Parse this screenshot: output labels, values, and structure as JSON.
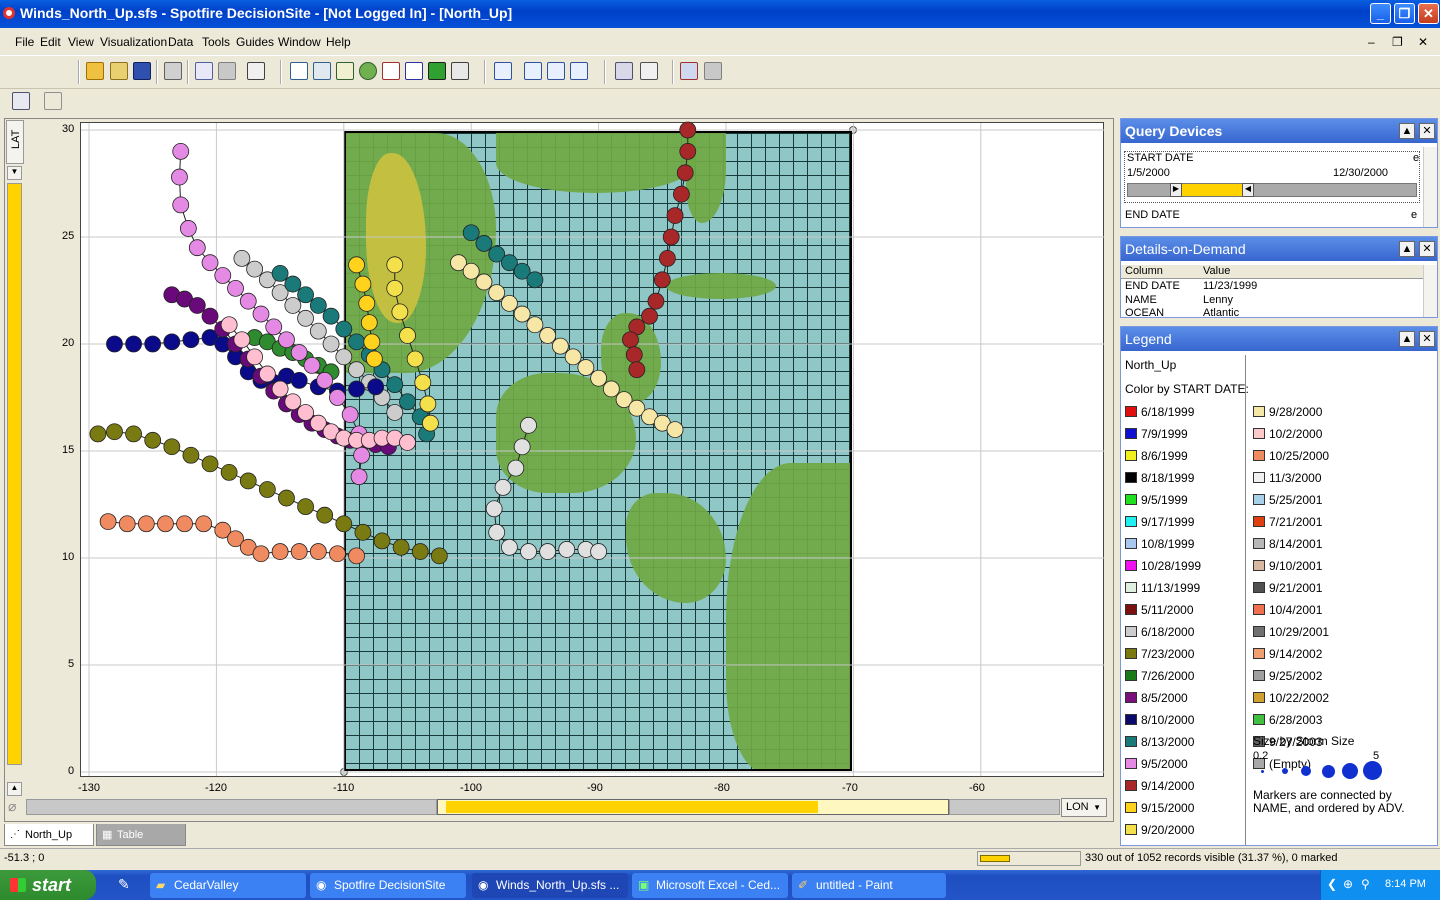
{
  "window": {
    "title": "Winds_North_Up.sfs - Spotfire DecisionSite - [Not Logged In] - [North_Up]"
  },
  "menu": [
    "File",
    "Edit",
    "View",
    "Visualization",
    "Data",
    "Tools",
    "Guides",
    "Window",
    "Help"
  ],
  "visualization": {
    "y_axis_label": "LAT",
    "x_axis_selector": "LON",
    "y_ticks": [
      "30",
      "25",
      "20",
      "15",
      "10",
      "5",
      "0"
    ],
    "x_ticks": [
      "-130",
      "-120",
      "-110",
      "-100",
      "-90",
      "-80",
      "-70",
      "-60"
    ]
  },
  "chart_data": {
    "type": "scatter",
    "xlim": [
      -130,
      -60
    ],
    "ylim": [
      0,
      30
    ],
    "series": [
      {
        "name": "7/26/2000",
        "color": "#2e8b2e",
        "points": [
          [
            -117,
            20.3
          ],
          [
            -116,
            20.1
          ],
          [
            -115,
            19.8
          ],
          [
            -114,
            19.6
          ],
          [
            -113,
            19.3
          ],
          [
            -112,
            19
          ],
          [
            -111,
            18.7
          ]
        ]
      },
      {
        "name": "6/18/2000",
        "color": "#cccccc",
        "points": [
          [
            -118,
            24
          ],
          [
            -117,
            23.5
          ],
          [
            -116,
            23
          ],
          [
            -115,
            22.4
          ],
          [
            -114,
            21.8
          ],
          [
            -113,
            21.2
          ],
          [
            -112,
            20.6
          ],
          [
            -111,
            20
          ],
          [
            -110,
            19.4
          ],
          [
            -109,
            18.8
          ],
          [
            -108,
            18.2
          ],
          [
            -107,
            17.5
          ],
          [
            -106,
            16.8
          ]
        ]
      },
      {
        "name": "7/23/2000",
        "color": "#7a7a12",
        "points": [
          [
            -129.3,
            15.8
          ],
          [
            -128,
            15.9
          ],
          [
            -126.5,
            15.8
          ],
          [
            -125,
            15.5
          ],
          [
            -123.5,
            15.2
          ],
          [
            -122,
            14.8
          ],
          [
            -120.5,
            14.4
          ],
          [
            -119,
            14
          ],
          [
            -117.5,
            13.6
          ],
          [
            -116,
            13.2
          ],
          [
            -114.5,
            12.8
          ],
          [
            -113,
            12.4
          ],
          [
            -111.5,
            12
          ],
          [
            -110,
            11.6
          ],
          [
            -108.5,
            11.2
          ],
          [
            -107,
            10.8
          ],
          [
            -105.5,
            10.5
          ],
          [
            -104,
            10.3
          ],
          [
            -102.5,
            10.1
          ]
        ]
      },
      {
        "name": "9/14/2002",
        "color": "#f08a60",
        "points": [
          [
            -128.5,
            11.7
          ],
          [
            -127,
            11.6
          ],
          [
            -125.5,
            11.6
          ],
          [
            -124,
            11.6
          ],
          [
            -122.5,
            11.6
          ],
          [
            -121,
            11.6
          ],
          [
            -119.5,
            11.3
          ],
          [
            -118.5,
            10.9
          ],
          [
            -117.5,
            10.5
          ],
          [
            -116.5,
            10.2
          ],
          [
            -115,
            10.3
          ],
          [
            -113.5,
            10.3
          ],
          [
            -112,
            10.3
          ],
          [
            -110.5,
            10.2
          ],
          [
            -109,
            10.1
          ]
        ]
      },
      {
        "name": "8/10/2000",
        "color": "#0a0a8a",
        "points": [
          [
            -128,
            20
          ],
          [
            -126.5,
            20
          ],
          [
            -125,
            20
          ],
          [
            -123.5,
            20.1
          ],
          [
            -122,
            20.2
          ],
          [
            -120.5,
            20.3
          ],
          [
            -119.5,
            20
          ],
          [
            -118.5,
            19.4
          ],
          [
            -117.5,
            18.7
          ],
          [
            -116.5,
            18.3
          ],
          [
            -115.5,
            18.2
          ],
          [
            -114.5,
            18.5
          ],
          [
            -113.5,
            18.3
          ],
          [
            -112,
            18
          ],
          [
            -110.5,
            17.8
          ],
          [
            -109,
            17.9
          ],
          [
            -107.5,
            18
          ]
        ]
      },
      {
        "name": "8/5/2000",
        "color": "#6a0a7a",
        "points": [
          [
            -123.5,
            22.3
          ],
          [
            -122.5,
            22.1
          ],
          [
            -121.5,
            21.8
          ],
          [
            -120.5,
            21.3
          ],
          [
            -119.5,
            20.7
          ],
          [
            -118.5,
            20
          ],
          [
            -117.5,
            19.3
          ],
          [
            -116.5,
            18.5
          ],
          [
            -115.5,
            17.8
          ],
          [
            -114.5,
            17.2
          ],
          [
            -113.5,
            16.7
          ],
          [
            -112.5,
            16.3
          ],
          [
            -111.5,
            16
          ],
          [
            -110.5,
            15.7
          ],
          [
            -109.5,
            15.5
          ],
          [
            -108.5,
            15.4
          ],
          [
            -107.5,
            15.3
          ],
          [
            -106.5,
            15.2
          ]
        ]
      },
      {
        "name": "9/5/2000",
        "color": "#e48ae4",
        "points": [
          [
            -122.8,
            29
          ],
          [
            -122.9,
            27.8
          ],
          [
            -122.8,
            26.5
          ],
          [
            -122.2,
            25.4
          ],
          [
            -121.5,
            24.5
          ],
          [
            -120.5,
            23.8
          ],
          [
            -119.5,
            23.2
          ],
          [
            -118.5,
            22.6
          ],
          [
            -117.5,
            22
          ],
          [
            -116.5,
            21.4
          ],
          [
            -115.5,
            20.8
          ],
          [
            -114.5,
            20.2
          ],
          [
            -113.5,
            19.6
          ],
          [
            -112.5,
            19
          ],
          [
            -111.5,
            18.3
          ],
          [
            -110.5,
            17.5
          ],
          [
            -109.5,
            16.7
          ],
          [
            -108.8,
            15.8
          ],
          [
            -108.6,
            14.8
          ],
          [
            -108.8,
            13.8
          ]
        ]
      },
      {
        "name": "10/28/1999",
        "color": "#ffbfd0",
        "points": [
          [
            -119,
            20.9
          ],
          [
            -118,
            20.2
          ],
          [
            -117,
            19.4
          ],
          [
            -116,
            18.6
          ],
          [
            -115,
            17.9
          ],
          [
            -114,
            17.3
          ],
          [
            -113,
            16.8
          ],
          [
            -112,
            16.3
          ],
          [
            -111,
            15.9
          ],
          [
            -110,
            15.6
          ],
          [
            -109,
            15.5
          ],
          [
            -108,
            15.5
          ],
          [
            -107,
            15.6
          ],
          [
            -106,
            15.6
          ],
          [
            -105,
            15.4
          ]
        ]
      },
      {
        "name": "8/13/2000",
        "color": "#1a7a7a",
        "points": [
          [
            -100,
            25.2
          ],
          [
            -99,
            24.7
          ],
          [
            -98,
            24.2
          ],
          [
            -97,
            23.8
          ],
          [
            -96,
            23.4
          ],
          [
            -95,
            23
          ]
        ],
        "extra": [
          [
            -115,
            23.3
          ],
          [
            -114,
            22.8
          ],
          [
            -113,
            22.3
          ],
          [
            -112,
            21.8
          ],
          [
            -111,
            21.3
          ],
          [
            -110,
            20.7
          ],
          [
            -109,
            20.1
          ],
          [
            -108,
            19.5
          ],
          [
            -107,
            18.8
          ],
          [
            -106,
            18.1
          ],
          [
            -105,
            17.3
          ],
          [
            -104,
            16.6
          ],
          [
            -103.5,
            15.8
          ]
        ]
      },
      {
        "name": "9/28/2000",
        "color": "#f7e7a7",
        "points": [
          [
            -101,
            23.8
          ],
          [
            -100,
            23.4
          ],
          [
            -99,
            22.9
          ],
          [
            -98,
            22.4
          ],
          [
            -97,
            21.9
          ],
          [
            -96,
            21.4
          ],
          [
            -95,
            20.9
          ],
          [
            -94,
            20.4
          ],
          [
            -93,
            19.9
          ],
          [
            -92,
            19.4
          ],
          [
            -91,
            18.9
          ],
          [
            -90,
            18.4
          ],
          [
            -89,
            17.9
          ],
          [
            -88,
            17.4
          ],
          [
            -87,
            17
          ],
          [
            -86,
            16.6
          ],
          [
            -85,
            16.3
          ],
          [
            -84,
            16
          ]
        ]
      },
      {
        "name": "9/14/2000",
        "color": "#a8282a",
        "points": [
          [
            -83,
            30
          ],
          [
            -83,
            29
          ],
          [
            -83.2,
            28
          ],
          [
            -83.5,
            27
          ],
          [
            -84,
            26
          ],
          [
            -84.3,
            25
          ],
          [
            -84.6,
            24
          ],
          [
            -85,
            23
          ],
          [
            -85.5,
            22
          ],
          [
            -86,
            21.3
          ],
          [
            -87,
            20.8
          ],
          [
            -87.5,
            20.2
          ],
          [
            -87.2,
            19.5
          ],
          [
            -87,
            18.8
          ]
        ]
      },
      {
        "name": "9/15/2000",
        "color": "#ffd21e",
        "points": [
          [
            -109,
            23.7
          ],
          [
            -108.5,
            22.8
          ],
          [
            -108.2,
            21.9
          ],
          [
            -108,
            21
          ],
          [
            -107.8,
            20.1
          ],
          [
            -107.6,
            19.3
          ]
        ]
      },
      {
        "name": "9/20/2000",
        "color": "#f4e04a",
        "points": [
          [
            -106,
            23.7
          ],
          [
            -106,
            22.6
          ],
          [
            -105.6,
            21.5
          ],
          [
            -105,
            20.4
          ],
          [
            -104.4,
            19.3
          ],
          [
            -103.8,
            18.2
          ],
          [
            -103.4,
            17.2
          ],
          [
            -103.2,
            16.3
          ]
        ]
      },
      {
        "name": "11/3/2000",
        "color": "#e0e0e0",
        "points": [
          [
            -95.5,
            16.2
          ],
          [
            -96,
            15.2
          ],
          [
            -96.5,
            14.2
          ],
          [
            -97.5,
            13.3
          ],
          [
            -98.2,
            12.3
          ],
          [
            -98,
            11.2
          ],
          [
            -97,
            10.5
          ],
          [
            -95.5,
            10.3
          ],
          [
            -94,
            10.3
          ],
          [
            -92.5,
            10.4
          ],
          [
            -91,
            10.4
          ],
          [
            -90,
            10.3
          ]
        ]
      }
    ]
  },
  "panels": {
    "query": {
      "title": "Query Devices",
      "start_label": "START DATE",
      "start_min": "1/5/2000",
      "start_max": "12/30/2000",
      "end_label": "END DATE"
    },
    "details": {
      "title": "Details-on-Demand",
      "col_header": "Column",
      "val_header": "Value",
      "rows": [
        {
          "col": "END DATE",
          "val": "11/23/1999"
        },
        {
          "col": "NAME",
          "val": "Lenny"
        },
        {
          "col": "OCEAN",
          "val": "Atlantic"
        }
      ]
    },
    "legend": {
      "title": "Legend",
      "viz_name": "North_Up",
      "color_by": "Color by START DATE:",
      "col1": [
        {
          "label": "6/18/1999",
          "color": "#e01010"
        },
        {
          "label": "7/9/1999",
          "color": "#1010d0"
        },
        {
          "label": "8/6/1999",
          "color": "#f0f020"
        },
        {
          "label": "8/18/1999",
          "color": "#000000"
        },
        {
          "label": "9/5/1999",
          "color": "#20e020"
        },
        {
          "label": "9/17/1999",
          "color": "#20f0f0"
        },
        {
          "label": "10/8/1999",
          "color": "#a8c8f0"
        },
        {
          "label": "10/28/1999",
          "color": "#f010f0"
        },
        {
          "label": "11/13/1999",
          "color": "#e0f0e0"
        },
        {
          "label": "5/11/2000",
          "color": "#7a1010"
        },
        {
          "label": "6/18/2000",
          "color": "#cccccc"
        },
        {
          "label": "7/23/2000",
          "color": "#7a7a12"
        },
        {
          "label": "7/26/2000",
          "color": "#1a7a1a"
        },
        {
          "label": "8/5/2000",
          "color": "#7a107a"
        },
        {
          "label": "8/10/2000",
          "color": "#0a0a6a"
        },
        {
          "label": "8/13/2000",
          "color": "#1a7a7a"
        },
        {
          "label": "9/5/2000",
          "color": "#e48ae4"
        },
        {
          "label": "9/14/2000",
          "color": "#a8282a"
        },
        {
          "label": "9/15/2000",
          "color": "#ffd21e"
        },
        {
          "label": "9/20/2000",
          "color": "#f4e04a"
        }
      ],
      "col2": [
        {
          "label": "9/28/2000",
          "color": "#f7e7a7"
        },
        {
          "label": "10/2/2000",
          "color": "#ffc8c8"
        },
        {
          "label": "10/25/2000",
          "color": "#f08a60"
        },
        {
          "label": "11/3/2000",
          "color": "#f0f0f0"
        },
        {
          "label": "5/25/2001",
          "color": "#a8d0e8"
        },
        {
          "label": "7/21/2001",
          "color": "#e04010"
        },
        {
          "label": "8/14/2001",
          "color": "#b8b8b8"
        },
        {
          "label": "9/10/2001",
          "color": "#d8b8a0"
        },
        {
          "label": "9/21/2001",
          "color": "#505050"
        },
        {
          "label": "10/4/2001",
          "color": "#f07050"
        },
        {
          "label": "10/29/2001",
          "color": "#707070"
        },
        {
          "label": "9/14/2002",
          "color": "#f0a070"
        },
        {
          "label": "9/25/2002",
          "color": "#a0a0a0"
        },
        {
          "label": "10/22/2002",
          "color": "#d0a030"
        },
        {
          "label": "6/28/2003",
          "color": "#40c040"
        },
        {
          "label": "9/27/2003",
          "color": "#606060"
        },
        {
          "label": "(Empty)",
          "color": "#a8a8a8"
        }
      ],
      "size_by": "Size by Storm Size",
      "size_min": "0.2",
      "size_max": "5",
      "note": "Markers are connected by NAME, and ordered by ADV."
    }
  },
  "tabs": {
    "north_up": "North_Up",
    "table": "Table"
  },
  "status": {
    "coords": "-51.3 ; 0",
    "records": "330 out of 1052 records visible (31.37 %), 0 marked"
  },
  "taskbar": {
    "start": "start",
    "tasks": [
      "CedarValley",
      "Spotfire DecisionSite",
      "Winds_North_Up.sfs ...",
      "Microsoft Excel - Ced...",
      "untitled - Paint"
    ],
    "time": "8:14 PM"
  },
  "colors": {
    "accent": "#ffd200",
    "title_bar": "#0a5fe0"
  }
}
